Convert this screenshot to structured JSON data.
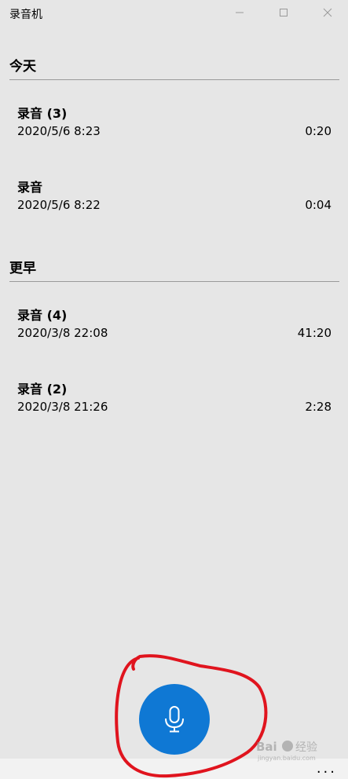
{
  "window": {
    "title": "录音机",
    "controls": {
      "minimize_icon": "minimize-icon",
      "maximize_icon": "maximize-icon",
      "close_icon": "close-icon"
    }
  },
  "sections": [
    {
      "header": "今天",
      "items": [
        {
          "name": "录音 (3)",
          "date": "2020/5/6 8:23",
          "duration": "0:20"
        },
        {
          "name": "录音",
          "date": "2020/5/6 8:22",
          "duration": "0:04"
        }
      ]
    },
    {
      "header": "更早",
      "items": [
        {
          "name": "录音 (4)",
          "date": "2020/3/8 22:08",
          "duration": "41:20"
        },
        {
          "name": "录音 (2)",
          "date": "2020/3/8 21:26",
          "duration": "2:28"
        }
      ]
    }
  ],
  "record_button": {
    "icon": "microphone-icon",
    "color": "#0f78d4"
  },
  "more_button": {
    "label": "...",
    "icon": "more-icon"
  },
  "annotation": {
    "color": "#e0141e"
  },
  "watermark": {
    "text": "Bai du 经验",
    "subtext": "jingyan.baidu.com"
  }
}
